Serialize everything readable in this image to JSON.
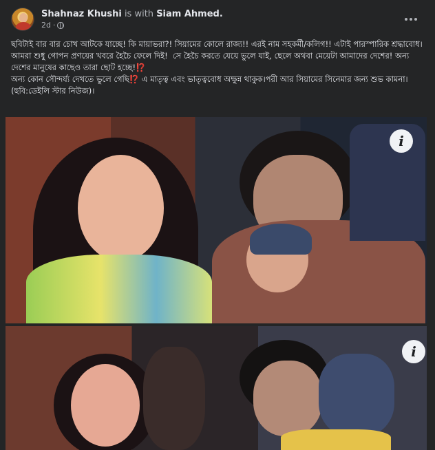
{
  "post": {
    "author": "Shahnaz Khushi",
    "with_text": "is with",
    "tagged": "Siam Ahmed.",
    "time": "2d",
    "dot": "·",
    "paragraphs": [
      "ছবিটাই বার বার চোখ আটকে যাচ্ছে! কি মায়াভরা?! সিয়ামের কোলে রাজ্য!! এরই নাম সহকর্মী/কলিগ!! এটাই পারস্পারিক শ্রদ্ধাবোধ।",
      "আমরা শুধু গোপন প্রণয়ের খবরে হৈচৈ ফেলে দিই!  সে হৈচৈ করতে যেয়ে ভুলে যাই, ছেলে অথবা মেয়েটা আমাদের দেশের! অন্য দেশের মানুষের কাছেও তারা ছোট হচ্ছে!⁉️",
      "অন্য কোন সৌন্দর্য্য দেখতে ভুলে গেছি⁉️ এ মাতৃত্ব এবং ভাতৃত্ববোধ অক্ষুন্ন থাকুক।পরী আর সিয়ামের সিনেমার জন্য শুভ কামনা।(ছবি:ডেইলি স্টার নিউজ)।"
    ],
    "info_glyph": "i"
  }
}
